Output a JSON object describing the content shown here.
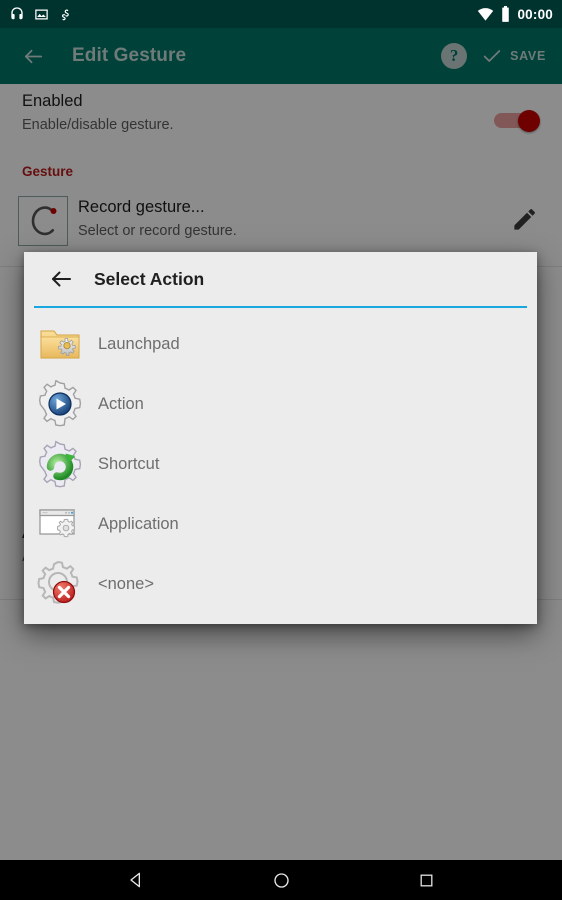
{
  "status_bar": {
    "icons": [
      "headphones-icon",
      "screenshot-image-icon",
      "gesture-squiggle-icon"
    ],
    "wifi_icon": "wifi-icon",
    "battery_icon": "battery-icon",
    "time": "00:00",
    "background": "#00332e"
  },
  "app_bar": {
    "back_icon": "back-arrow-icon",
    "title": "Edit Gesture",
    "help_icon": "help-question-icon",
    "help_glyph": "?",
    "save_icon": "checkmark-icon",
    "save_label": "SAVE",
    "background": "#00413a",
    "dimmed_text_color": "#6f7b79"
  },
  "content": {
    "enabled": {
      "title": "Enabled",
      "description": "Enable/disable gesture.",
      "toggle_on": true,
      "toggle_color": "#c40000"
    },
    "gesture_section": {
      "header": "Gesture",
      "header_color": "#b71c1c",
      "record_title": "Record gesture...",
      "record_description": "Select or record gesture.",
      "thumb_icon": "gesture-stroke-c-icon",
      "edit_icon": "pencil-edit-icon"
    },
    "advanced": {
      "title": "Advanced options",
      "description": "Advanced options like is gesture active on keyboard or lockscreen, etc."
    }
  },
  "dialog": {
    "back_icon": "back-arrow-icon",
    "title": "Select Action",
    "accent_color": "#19a7e0",
    "background": "#ececec",
    "items": [
      {
        "label": "Launchpad",
        "icon": "folder-gear-icon"
      },
      {
        "label": "Action",
        "icon": "gear-play-icon"
      },
      {
        "label": "Shortcut",
        "icon": "gear-green-arrow-icon"
      },
      {
        "label": "Application",
        "icon": "window-gear-icon"
      },
      {
        "label": "<none>",
        "icon": "gear-red-x-icon"
      }
    ]
  },
  "nav_bar": {
    "back_icon": "nav-back-triangle-icon",
    "home_icon": "nav-home-circle-icon",
    "recents_icon": "nav-recents-square-icon"
  }
}
